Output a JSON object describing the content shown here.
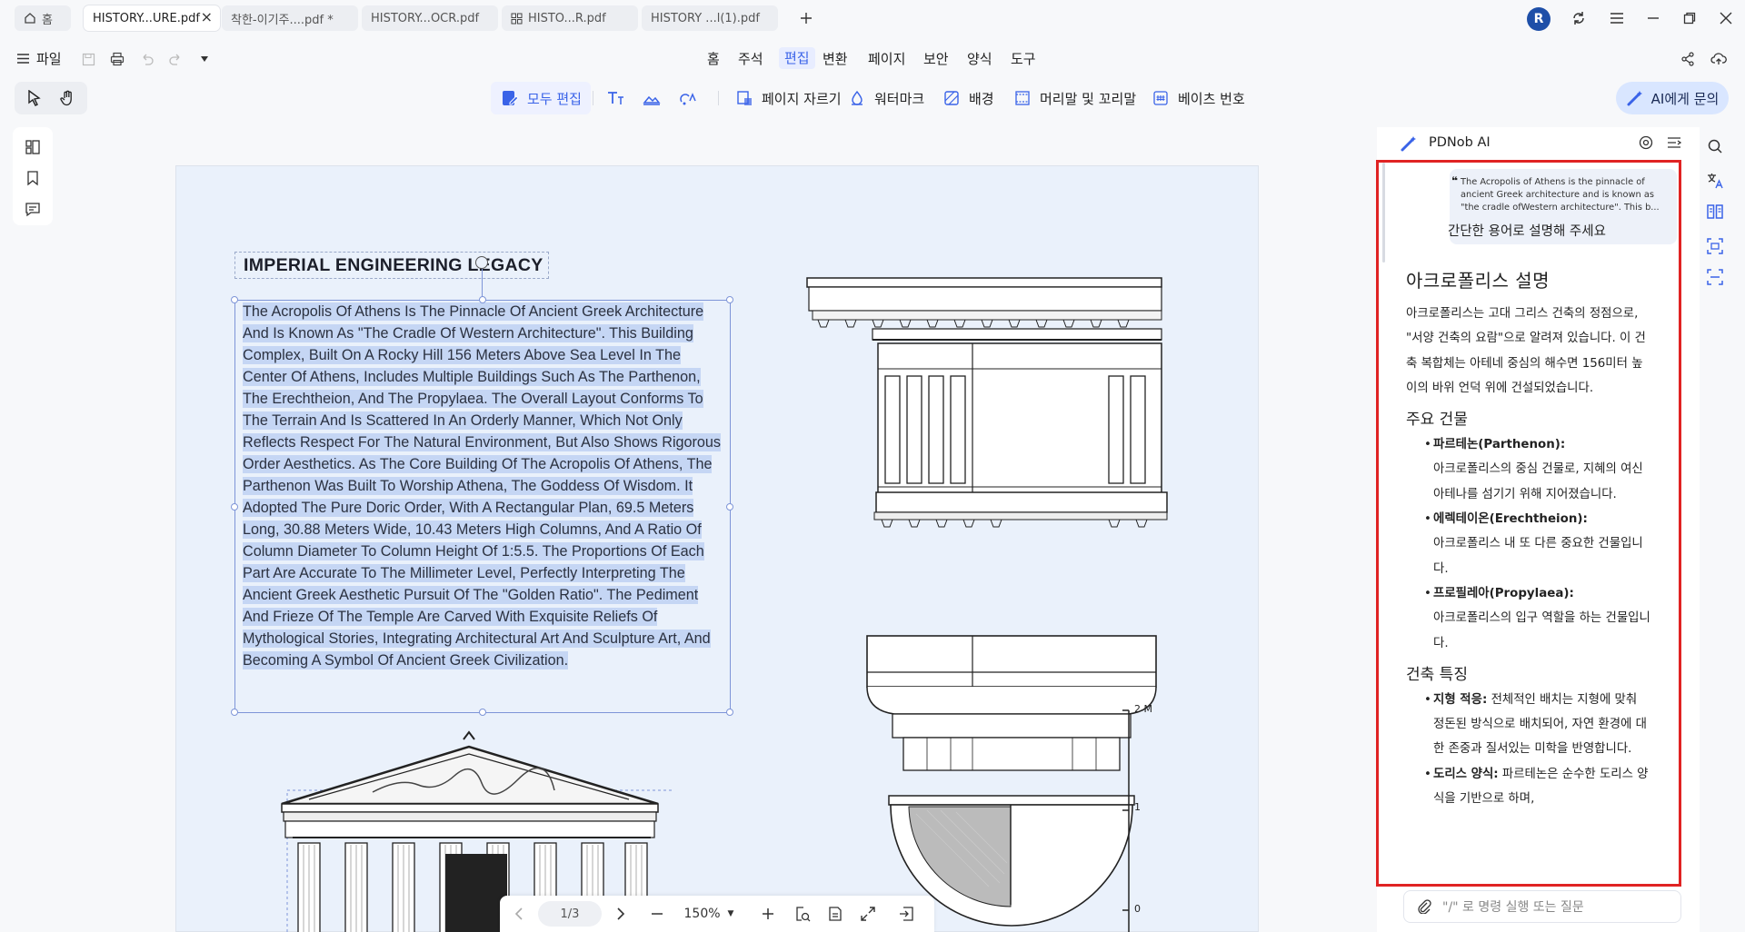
{
  "tabs": [
    {
      "label": "홈",
      "icon": "home-icon",
      "active": false
    },
    {
      "label": "HISTORY...URE.pdf",
      "active": true
    },
    {
      "label": "착한-이기주....pdf *",
      "active": false
    },
    {
      "label": "HISTORY...OCR.pdf",
      "active": false
    },
    {
      "label": "HISTO...R.pdf",
      "icon": "grid-icon",
      "active": false
    },
    {
      "label": "HISTORY ...l(1).pdf",
      "active": false
    }
  ],
  "user": {
    "avatar_letter": "R"
  },
  "menu": {
    "file": "파일",
    "items": [
      "홈",
      "주석",
      "편집",
      "변환",
      "페이지",
      "보안",
      "양식",
      "도구"
    ],
    "active": "편집"
  },
  "edit_toolbar": {
    "edit_all": "모두 편집",
    "crop": "페이지 자르기",
    "watermark": "워터마크",
    "background": "배경",
    "header_footer": "머리말 및 꼬리말",
    "bates": "베이츠 번호"
  },
  "ask_ai_button": "AI에게 문의",
  "document": {
    "title": "IMPERIAL ENGINEERING LEGACY",
    "body": "The Acropolis Of Athens Is The Pinnacle Of Ancient Greek Architecture And Is Known As \"The Cradle Of Western Architecture\". This Building Complex, Built On A Rocky Hill 156 Meters Above Sea Level In The Center Of Athens, Includes Multiple Buildings Such As The Parthenon, The Erechtheion, And The Propylaea. The Overall Layout Conforms To The Terrain And Is Scattered In An Orderly Manner, Which Not Only Reflects Respect For The Natural Environment, But Also Shows Rigorous Order Aesthetics. As The Core Building Of The Acropolis Of Athens, The Parthenon Was Built To Worship Athena, The Goddess Of Wisdom. It Adopted The Pure Doric Order, With A Rectangular Plan, 69.5 Meters Long, 30.88 Meters Wide, 10.43 Meters High Columns, And A Ratio Of Column Diameter To Column Height Of 1:5.5. The Proportions Of Each Part Are Accurate To The Millimeter Level, Perfectly Interpreting The Ancient Greek Aesthetic Pursuit Of The \"Golden Ratio\". The Pediment And Frieze Of The Temple Are Carved With Exquisite Reliefs Of Mythological Stories, Integrating Architectural Art And Sculpture Art, And Becoming A Symbol Of Ancient Greek Civilization.",
    "scale_labels": [
      "2 M",
      "1",
      "0"
    ]
  },
  "zoom": {
    "page_indicator": "1/3",
    "level": "150%"
  },
  "ai_panel": {
    "title": "PDNob AI",
    "quote": "The Acropolis of Athens is the pinnacle of ancient Greek architecture and is known as \"the cradle ofWestern architecture\". This b...",
    "question": "간단한 용어로 설명해 주세요",
    "answer_title": "아크로폴리스 설명",
    "answer_intro": "아크로폴리스는 고대 그리스 건축의 정점으로, \"서양 건축의 요람\"으로 알려져 있습니다. 이 건축 복합체는 아테네 중심의 해수면 156미터 높이의 바위 언덕 위에 건설되었습니다.",
    "section1_title": "주요 건물",
    "buildings": [
      {
        "name": "파르테논(Parthenon):",
        "desc": "아크로폴리스의 중심 건물로, 지혜의 여신 아테나를 섬기기 위해 지어졌습니다."
      },
      {
        "name": "에렉테이온(Erechtheion):",
        "desc": "아크로폴리스 내 또 다른 중요한 건물입니다."
      },
      {
        "name": "프로필레아(Propylaea):",
        "desc": "아크로폴리스의 입구 역할을 하는 건물입니다."
      }
    ],
    "section2_title": "건축 특징",
    "features": [
      {
        "name": "지형 적응:",
        "desc": "전체적인 배치는 지형에 맞춰 정돈된 방식으로 배치되어, 자연 환경에 대한 존중과 질서있는 미학을 반영합니다."
      },
      {
        "name": "도리스 양식:",
        "desc": "파르테논은 순수한 도리스 양식을 기반으로 하며,"
      }
    ],
    "input_placeholder": "\"/\" 로 명령 실행 또는 질문"
  }
}
